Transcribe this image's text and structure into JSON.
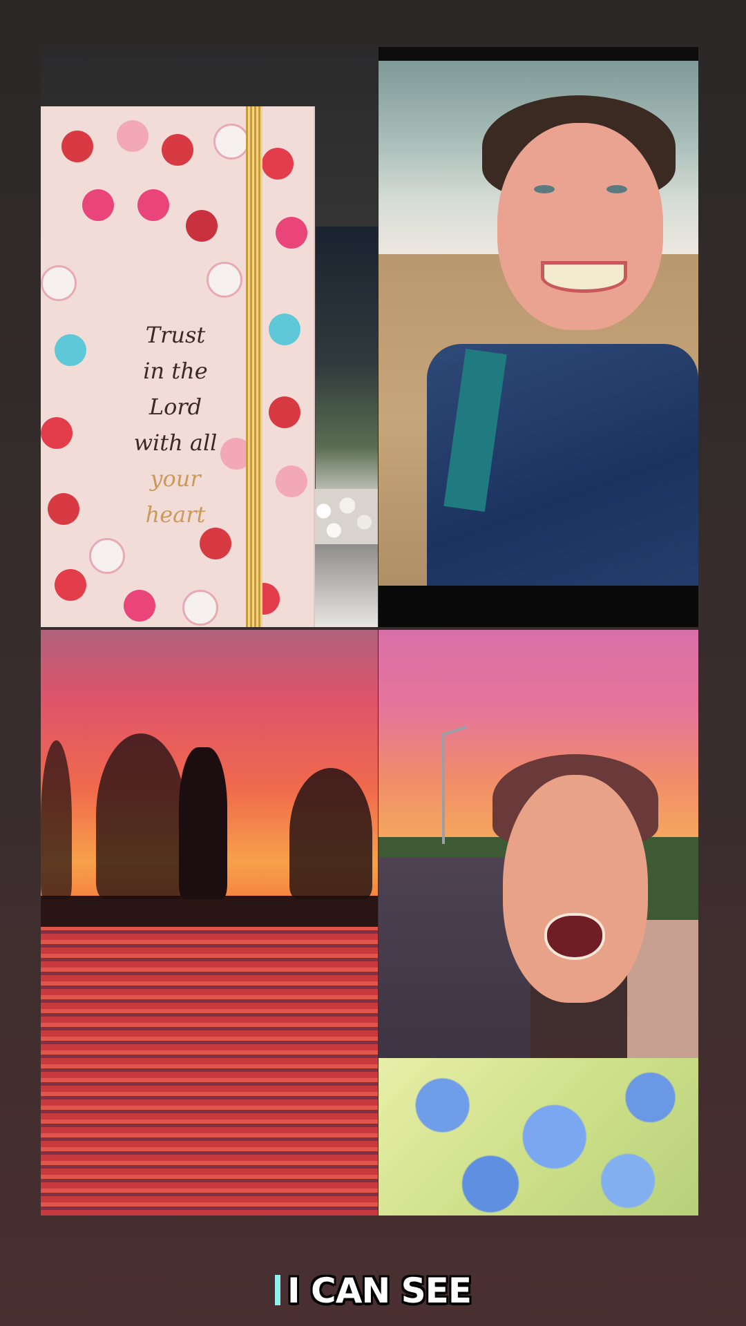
{
  "tiles": {
    "card": {
      "verse_lines": [
        "Trust",
        "in the",
        "Lord",
        "with all",
        "your",
        "heart"
      ]
    },
    "beach": {},
    "sunset": {},
    "street": {}
  },
  "caption": {
    "text": "I CAN SEE",
    "accent_color": "#8ff0f0"
  }
}
